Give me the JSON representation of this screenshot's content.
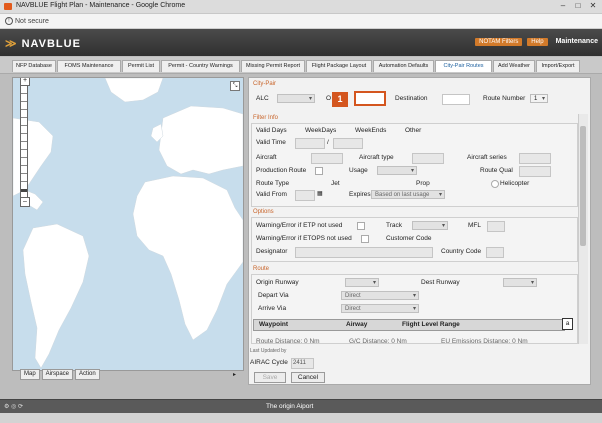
{
  "browser": {
    "tab_title": "NAVBLUE Flight Plan - Maintenance - Google Chrome",
    "security_label": "Not secure"
  },
  "app": {
    "logo": "NAVBLUE",
    "header_buttons": {
      "notam": "NOTAM Filters",
      "help": "Help",
      "mode": "Maintenance"
    }
  },
  "tabs": [
    "NFP Database",
    "FOMS Maintenance",
    "Permit List",
    "Permit - Country Warnings",
    "Missing Permit Report",
    "Flight Package Layout",
    "Automation Defaults",
    "City-Pair Routes",
    "Add Weather",
    "Import/Export"
  ],
  "active_tab": "City-Pair Routes",
  "map_buttons": [
    "Map",
    "Airspace",
    "Action"
  ],
  "city_pair": {
    "section": "City-Pair",
    "alc_label": "ALC",
    "origin_label": "O",
    "destination_label": "Destination",
    "route_number_label": "Route Number",
    "route_number_value": "1",
    "callout_number": "1"
  },
  "filter_info": {
    "section": "Filter Info",
    "valid_days": "Valid Days",
    "weekdays": "WeekDays",
    "weekends": "WeekEnds",
    "other": "Other",
    "valid_time": "Valid Time",
    "time_sep": "/",
    "aircraft": "Aircraft",
    "aircraft_type": "Aircraft type",
    "aircraft_series": "Aircraft series",
    "production_route": "Production Route",
    "usage": "Usage",
    "route_qual": "Route Qual",
    "route_type": "Route Type",
    "jet": "Jet",
    "prop": "Prop",
    "helicopter": "Helicopter",
    "valid_from": "Valid From",
    "expires": "Expires",
    "expires_select": "Based on last usage"
  },
  "options": {
    "section": "Options",
    "warning_etp": "Warning/Error if ETP not used",
    "track": "Track",
    "mfl": "MFL",
    "warning_etops": "Warning/Error if ETOPS not used",
    "customer_code": "Customer Code",
    "designator": "Designator",
    "country_code": "Country Code"
  },
  "route": {
    "section": "Route",
    "origin_runway": "Origin Runway",
    "dest_runway": "Dest Runway",
    "depart_via": "Depart Via",
    "arrive_via": "Arrive Via",
    "direct": "Direct",
    "columns": [
      "Waypoint",
      "Airway",
      "Flight Level Range"
    ],
    "add_icon": "a",
    "route_distance": "Route Distance: 0 Nm",
    "gc_distance": "G/C Distance: 0 Nm",
    "eu_emissions": "EU Emissions Distance: 0 Nm"
  },
  "footer": {
    "last_updated": "Last Updated by",
    "airac_label": "AIRAC Cycle",
    "airac_value": "2411",
    "save": "Save",
    "cancel": "Cancel"
  },
  "status_text": "The origin Aiport"
}
